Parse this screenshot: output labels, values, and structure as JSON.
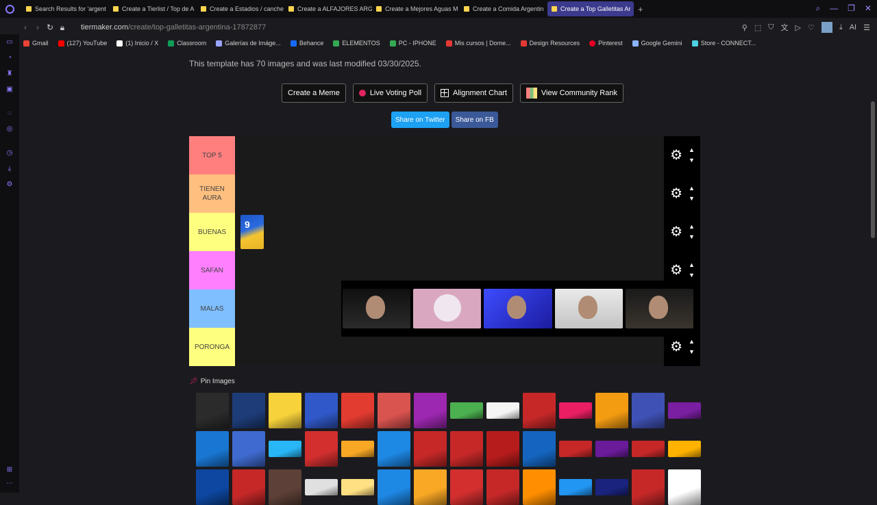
{
  "browser": {
    "tabs": [
      {
        "label": "Search Results for 'argent"
      },
      {
        "label": "Create a Tierlist / Top de A"
      },
      {
        "label": "Create a Estadios / canche"
      },
      {
        "label": "Create a ALFAJORES ARG"
      },
      {
        "label": "Create a Mejores Aguas M"
      },
      {
        "label": "Create a Comida Argentin"
      },
      {
        "label": "Create a Top Galletitas Ar"
      }
    ],
    "address": {
      "host": "tiermaker.com",
      "path": "/create/top-galletitas-argentina-17872877"
    },
    "bookmarks": [
      {
        "label": "Gmail",
        "color": "#ea4335"
      },
      {
        "label": "(127) YouTube",
        "color": "#ff0000"
      },
      {
        "label": "(1) Inicio / X",
        "color": "#ffffff"
      },
      {
        "label": "Classroom",
        "color": "#0f9d58"
      },
      {
        "label": "Galerías de Imáge...",
        "color": "#9aa4ff"
      },
      {
        "label": "Behance",
        "color": "#1769ff"
      },
      {
        "label": "ELEMENTOS",
        "color": "#34a853"
      },
      {
        "label": "PC - IPHONE",
        "color": "#34a853"
      },
      {
        "label": "Mis cursos | Dome...",
        "color": "#e53935"
      },
      {
        "label": "Design Resources",
        "color": "#e53935"
      },
      {
        "label": "Pinterest",
        "color": "#e60023"
      },
      {
        "label": "Google Gemini",
        "color": "#8ab4f8"
      },
      {
        "label": "Store - CONNECT..."
      }
    ]
  },
  "page": {
    "info": "This template has 70 images and was last modified 03/30/2025.",
    "buttons": {
      "create_meme": "Create a Meme",
      "live_voting": "Live Voting Poll",
      "alignment_chart": "Alignment Chart",
      "community_rank": "View Community Rank"
    },
    "share": {
      "twitter": "Share on Twitter",
      "fb": "Share on FB"
    },
    "tiers": [
      {
        "label": "TOP 5",
        "color": "#ff7f7f"
      },
      {
        "label": "TIENEN AURA",
        "color": "#ffbf7f"
      },
      {
        "label": "BUENAS",
        "color": "#ffff7f"
      },
      {
        "label": "SAFAN",
        "color": "#ff7fff"
      },
      {
        "label": "MALAS",
        "color": "#7fbfff"
      },
      {
        "label": "PORONGA",
        "color": "#ffff7f"
      }
    ],
    "pin_images": "Pin Images"
  },
  "snack_colors": [
    "#2b2b2b",
    "#1d3c78",
    "#f7d23b",
    "#3058c8",
    "#e23b30",
    "#d9534f",
    "#9c27b0",
    "#4caf50",
    "#f5f5f5",
    "#c62828",
    "#e91e63",
    "#f39c12",
    "#3f51b5",
    "#7b1fa2",
    "#1976d2",
    "#3f6bd1",
    "#29b6f6",
    "#d32f2f",
    "#f9a825",
    "#1e88e5",
    "#c62828",
    "#c62828",
    "#b71c1c",
    "#1565c0",
    "#c62828",
    "#6a1b9a",
    "#c62828",
    "#ffb300",
    "#0d47a1",
    "#c62828",
    "#5d4037",
    "#e0e0e0",
    "#ffe082",
    "#1e88e5",
    "#f9a825",
    "#d32f2f",
    "#c62828",
    "#ff8f00",
    "#2196f3",
    "#1a237e",
    "#c62828",
    "#ffffff"
  ]
}
